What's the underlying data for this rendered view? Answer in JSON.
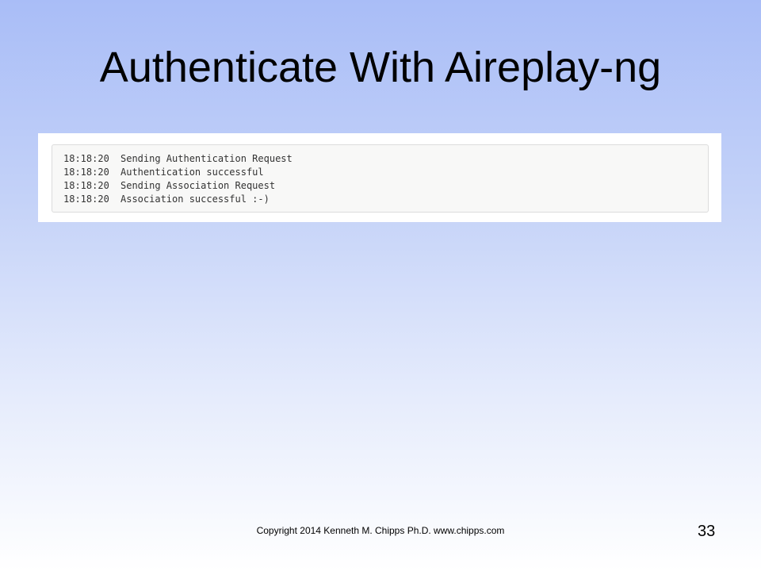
{
  "slide": {
    "title": "Authenticate With Aireplay-ng",
    "footer": "Copyright 2014 Kenneth M. Chipps Ph.D. www.chipps.com",
    "page_number": "33"
  },
  "terminal": {
    "lines": [
      {
        "time": "18:18:20",
        "message": "Sending Authentication Request"
      },
      {
        "time": "18:18:20",
        "message": "Authentication successful"
      },
      {
        "time": "18:18:20",
        "message": "Sending Association Request"
      },
      {
        "time": "18:18:20",
        "message": "Association successful :-)"
      }
    ]
  }
}
